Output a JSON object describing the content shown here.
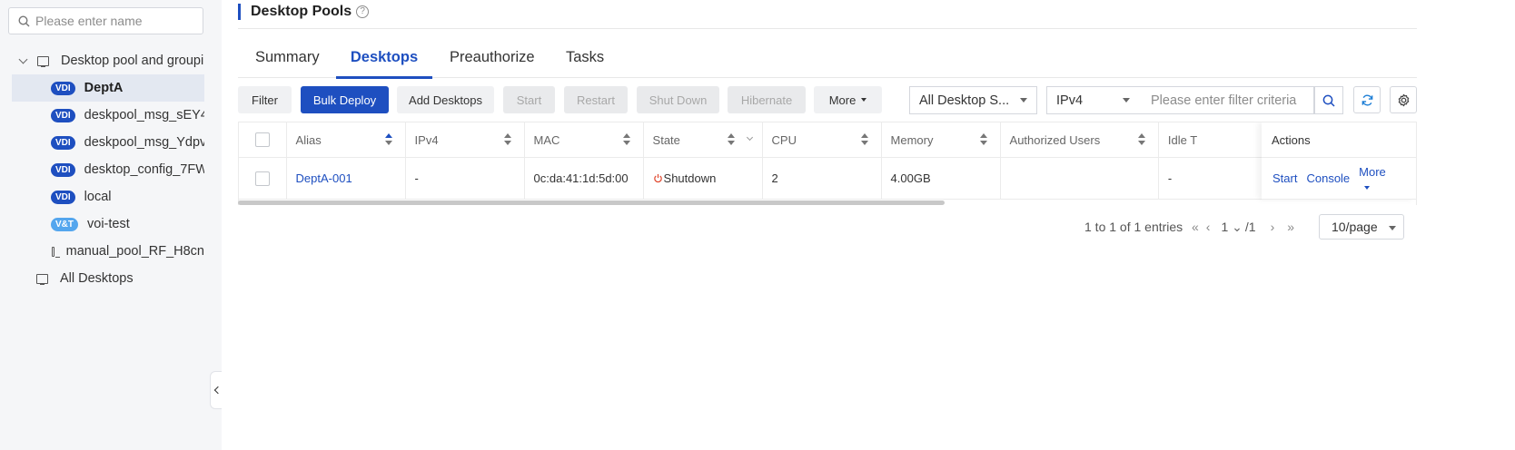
{
  "sidebar": {
    "search_placeholder": "Please enter name",
    "tree": [
      {
        "label": "Desktop pool and groupi",
        "type": "root"
      },
      {
        "label": "DeptA",
        "badge": "VDI",
        "selected": true
      },
      {
        "label": "deskpool_msg_sEY4",
        "badge": "VDI"
      },
      {
        "label": "deskpool_msg_Ydpv",
        "badge": "VDI"
      },
      {
        "label": "desktop_config_7FW",
        "badge": "VDI"
      },
      {
        "label": "local",
        "badge": "VDI"
      },
      {
        "label": "voi-test",
        "badge": "V&T"
      },
      {
        "label": "manual_pool_RF_H8cn",
        "type": "monitor"
      },
      {
        "label": "All Desktops",
        "type": "root-monitor"
      }
    ]
  },
  "header": {
    "title": "Desktop Pools",
    "help": "?"
  },
  "tabs": [
    "Summary",
    "Desktops",
    "Preauthorize",
    "Tasks"
  ],
  "active_tab": "Desktops",
  "toolbar": {
    "filter": "Filter",
    "bulk_deploy": "Bulk Deploy",
    "add_desktops": "Add Desktops",
    "start": "Start",
    "restart": "Restart",
    "shut_down": "Shut Down",
    "hibernate": "Hibernate",
    "more": "More",
    "desktop_state_select": "All Desktop S...",
    "ip_select": "IPv4",
    "filter_placeholder": "Please enter filter criteria"
  },
  "table": {
    "columns": [
      "Alias",
      "IPv4",
      "MAC",
      "State",
      "CPU",
      "Memory",
      "Authorized Users",
      "Idle T",
      "Actions"
    ],
    "rows": [
      {
        "alias": "DeptA-001",
        "ipv4": "-",
        "mac": "0c:da:41:1d:5d:00",
        "state": "Shutdown",
        "cpu": "2",
        "memory": "4.00GB",
        "authorized_users": "",
        "idle": "-",
        "actions": [
          "Start",
          "Console",
          "More"
        ]
      }
    ]
  },
  "pagination": {
    "summary": "1 to 1 of 1 entries",
    "current_page": "1",
    "total_pages": "/1",
    "page_size": "10/page"
  },
  "colors": {
    "accent": "#1e4fc0",
    "vdi_badge": "#1e4fc0",
    "vt_badge": "#54a6ee",
    "shutdown": "#e0452b"
  }
}
